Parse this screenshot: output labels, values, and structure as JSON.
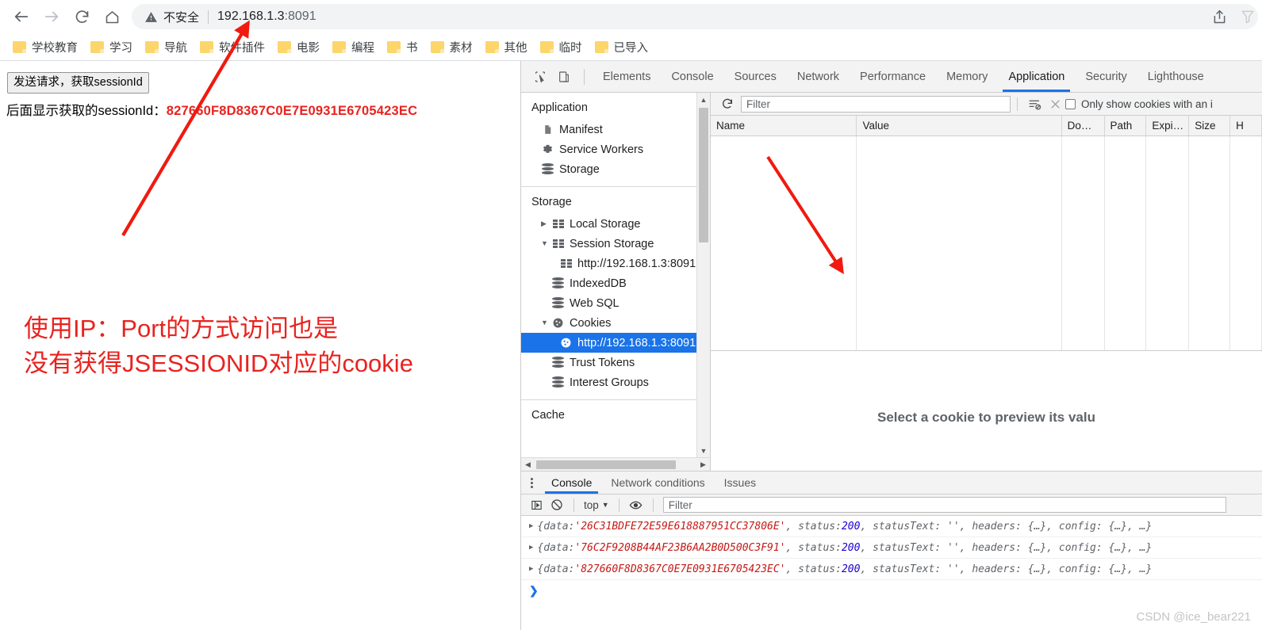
{
  "browser": {
    "nav": {
      "back_icon": "arrow-left-icon",
      "forward_icon": "arrow-right-icon",
      "reload_icon": "reload-icon",
      "home_icon": "home-icon"
    },
    "omnibox": {
      "security_icon": "warning-triangle-icon",
      "security_label": "不安全",
      "url_host": "192.168.1.3",
      "url_port": ":8091"
    },
    "share_icon": "share-icon",
    "bookmarks": [
      {
        "label": "学校教育"
      },
      {
        "label": "学习"
      },
      {
        "label": "导航"
      },
      {
        "label": "软件插件"
      },
      {
        "label": "电影"
      },
      {
        "label": "编程"
      },
      {
        "label": "书"
      },
      {
        "label": "素材"
      },
      {
        "label": "其他"
      },
      {
        "label": "临时"
      },
      {
        "label": "已导入"
      }
    ]
  },
  "page": {
    "button_label": "发送请求，获取sessionId",
    "session_prefix": "后面显示获取的sessionId：",
    "session_value": "827660F8D8367C0E7E0931E6705423EC",
    "annotation_line1": "使用IP：Port的方式访问也是",
    "annotation_line2": "没有获得JSESSIONID对应的cookie",
    "annotation_color": "#e8231f"
  },
  "devtools": {
    "inspect_icon": "inspect-cursor-icon",
    "device_icon": "device-toolbar-icon",
    "tabs": [
      {
        "label": "Elements",
        "active": false
      },
      {
        "label": "Console",
        "active": false
      },
      {
        "label": "Sources",
        "active": false
      },
      {
        "label": "Network",
        "active": false
      },
      {
        "label": "Performance",
        "active": false
      },
      {
        "label": "Memory",
        "active": false
      },
      {
        "label": "Application",
        "active": true
      },
      {
        "label": "Security",
        "active": false
      },
      {
        "label": "Lighthouse",
        "active": false
      }
    ],
    "sidebar": {
      "application_title": "Application",
      "application_items": [
        {
          "label": "Manifest",
          "icon": "document-icon"
        },
        {
          "label": "Service Workers",
          "icon": "gear-icon"
        },
        {
          "label": "Storage",
          "icon": "database-icon"
        }
      ],
      "storage_title": "Storage",
      "storage_items": [
        {
          "label": "Local Storage",
          "icon": "grid-icon",
          "twisty": "▶",
          "depth": 1,
          "selected": false
        },
        {
          "label": "Session Storage",
          "icon": "grid-icon",
          "twisty": "▼",
          "depth": 1,
          "selected": false
        },
        {
          "label": "http://192.168.1.3:8091",
          "icon": "grid-icon",
          "twisty": "",
          "depth": 2,
          "selected": false
        },
        {
          "label": "IndexedDB",
          "icon": "database-icon",
          "twisty": "",
          "depth": 1,
          "selected": false
        },
        {
          "label": "Web SQL",
          "icon": "database-icon",
          "twisty": "",
          "depth": 1,
          "selected": false
        },
        {
          "label": "Cookies",
          "icon": "cookie-icon",
          "twisty": "▼",
          "depth": 1,
          "selected": false
        },
        {
          "label": "http://192.168.1.3:8091",
          "icon": "cookie-icon",
          "twisty": "",
          "depth": 2,
          "selected": true
        },
        {
          "label": "Trust Tokens",
          "icon": "database-icon",
          "twisty": "",
          "depth": 1,
          "selected": false
        },
        {
          "label": "Interest Groups",
          "icon": "database-icon",
          "twisty": "",
          "depth": 1,
          "selected": false
        }
      ],
      "cache_title": "Cache"
    },
    "cookie_panel": {
      "refresh_icon": "refresh-icon",
      "filter_placeholder": "Filter",
      "clear_filtered_icon": "clear-filtered-cookies-icon",
      "clear_all_icon": "clear-all-cookies-icon",
      "checkbox_label": "Only show cookies with an i",
      "checkbox_checked": false,
      "columns": [
        "Name",
        "Value",
        "Do…",
        "Path",
        "Expi…",
        "Size",
        "H"
      ],
      "rows": [],
      "empty_preview_message": "Select a cookie to preview its valu"
    },
    "drawer": {
      "menu_icon": "kebab-menu-icon",
      "tabs": [
        {
          "label": "Console",
          "active": true
        },
        {
          "label": "Network conditions",
          "active": false
        },
        {
          "label": "Issues",
          "active": false
        }
      ],
      "toolbar": {
        "sidebar_icon": "console-sidebar-icon",
        "clear_icon": "clear-console-icon",
        "context": "top",
        "context_caret": "▼",
        "eye_icon": "live-expression-eye-icon",
        "filter_placeholder": "Filter"
      },
      "logs": [
        {
          "expand": "▶",
          "open": "{data: ",
          "value": "'26C31BDFE72E59E618887951CC37806E'",
          "mid1": ", status: ",
          "status": "200",
          "tail": ", statusText: '', headers: {…}, config: {…}, …}"
        },
        {
          "expand": "▶",
          "open": "{data: ",
          "value": "'76C2F9208B44AF23B6AA2B0D500C3F91'",
          "mid1": ", status: ",
          "status": "200",
          "tail": ", statusText: '', headers: {…}, config: {…}, …}"
        },
        {
          "expand": "▶",
          "open": "{data: ",
          "value": "'827660F8D8367C0E7E0931E6705423EC'",
          "mid1": ", status: ",
          "status": "200",
          "tail": ", statusText: '', headers: {…}, config: {…}, …}"
        }
      ],
      "prompt": "❯"
    }
  },
  "watermark": "CSDN @ice_bear221"
}
